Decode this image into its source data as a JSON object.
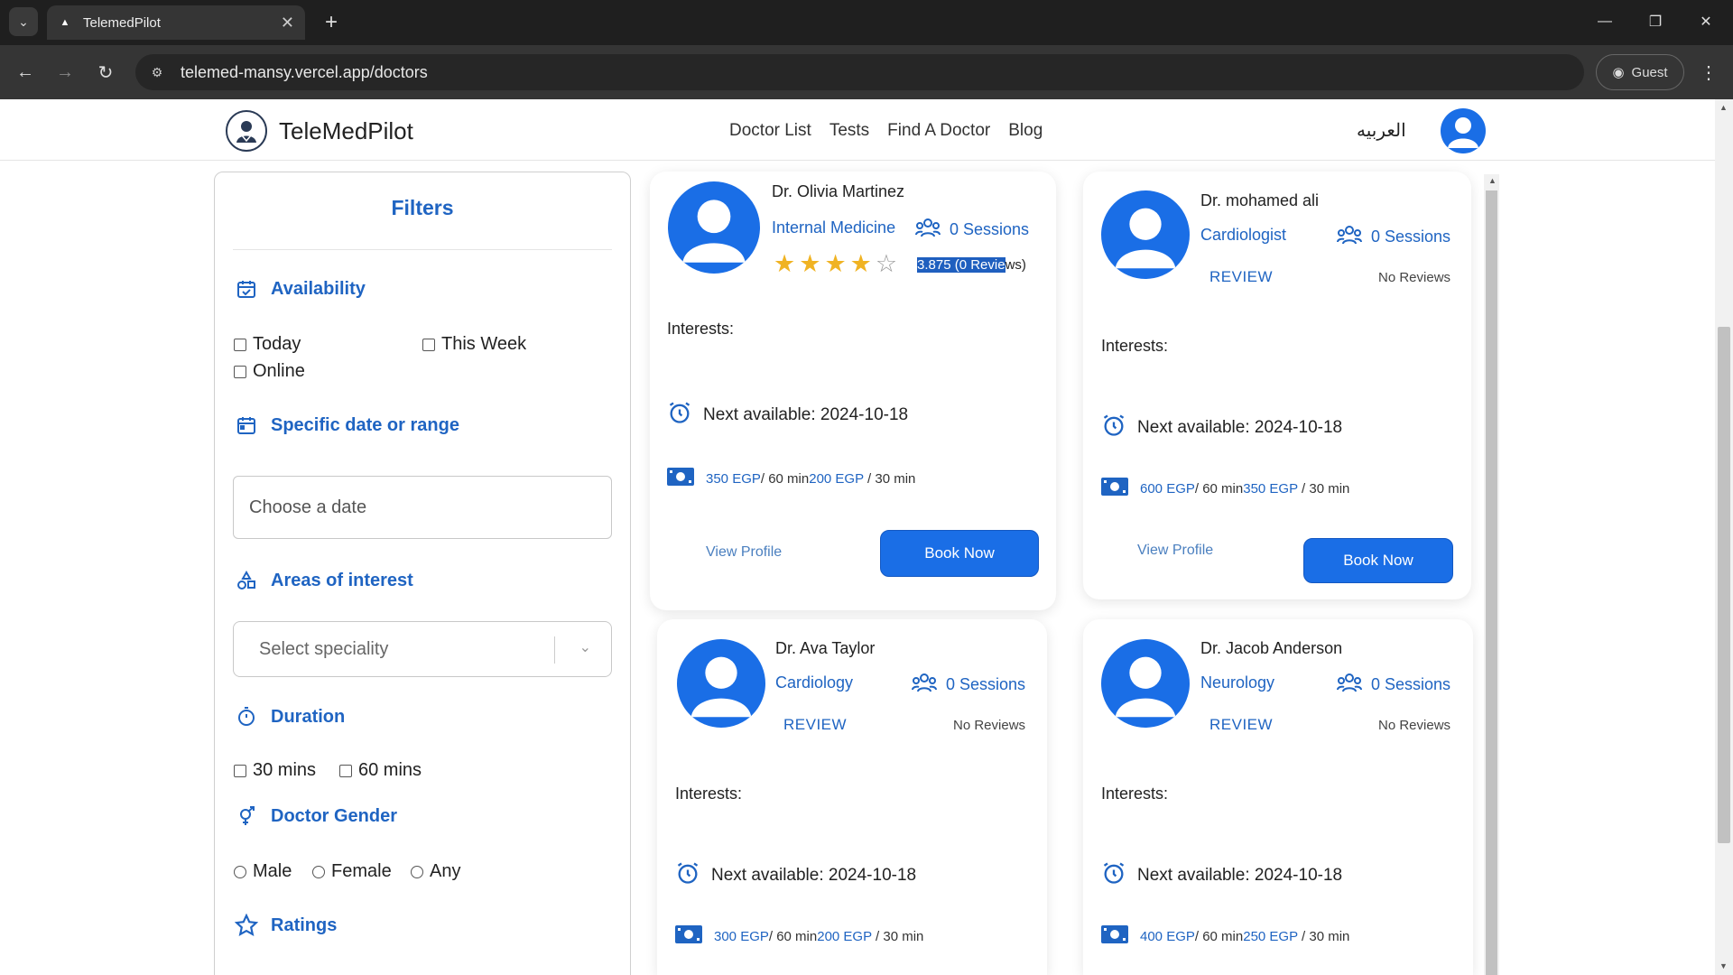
{
  "browser": {
    "tab_title": "TelemedPilot",
    "url": "telemed-mansy.vercel.app/doctors",
    "profile_label": "Guest"
  },
  "site": {
    "brand": "TeleMedPilot",
    "nav": [
      "Doctor List",
      "Tests",
      "Find A Doctor",
      "Blog"
    ],
    "language_toggle": "العربيه"
  },
  "filters": {
    "title": "Filters",
    "availability": {
      "heading": "Availability",
      "options": [
        "Today",
        "This Week",
        "Online"
      ]
    },
    "date": {
      "heading": "Specific date or range",
      "placeholder": "Choose a date"
    },
    "interests": {
      "heading": "Areas of interest",
      "placeholder": "Select speciality"
    },
    "duration": {
      "heading": "Duration",
      "options": [
        "30 mins",
        "60 mins"
      ]
    },
    "gender": {
      "heading": "Doctor Gender",
      "options": [
        "Male",
        "Female",
        "Any"
      ]
    },
    "ratings": {
      "heading": "Ratings"
    }
  },
  "doctors": [
    {
      "name": "Dr. Olivia Martinez",
      "specialty": "Internal Medicine",
      "sessions": "0 Sessions",
      "rating": 3.875,
      "rating_text_selected": "3.875 (0 Revie",
      "rating_text_rest": "ws)",
      "interests_label": "Interests:",
      "next_available": "Next available: 2024-10-18",
      "price_60": "350 EGP",
      "price_60_suffix": "/ 60 min",
      "price_30": "200 EGP",
      "price_30_suffix": " / 30 min",
      "view_profile": "View Profile",
      "book": "Book Now"
    },
    {
      "name": "Dr. mohamed ali",
      "specialty": "Cardiologist",
      "sessions": "0 Sessions",
      "review_link": "REVIEW",
      "no_reviews": "No Reviews",
      "interests_label": "Interests:",
      "next_available": "Next available: 2024-10-18",
      "price_60": "600 EGP",
      "price_60_suffix": "/ 60 min",
      "price_30": "350 EGP",
      "price_30_suffix": " / 30 min",
      "view_profile": "View Profile",
      "book": "Book Now"
    },
    {
      "name": "Dr. Ava Taylor",
      "specialty": "Cardiology",
      "sessions": "0 Sessions",
      "review_link": "REVIEW",
      "no_reviews": "No Reviews",
      "interests_label": "Interests:",
      "next_available": "Next available: 2024-10-18",
      "price_60": "300 EGP",
      "price_60_suffix": "/ 60 min",
      "price_30": "200 EGP",
      "price_30_suffix": " / 30 min"
    },
    {
      "name": "Dr. Jacob Anderson",
      "specialty": "Neurology",
      "sessions": "0 Sessions",
      "review_link": "REVIEW",
      "no_reviews": "No Reviews",
      "interests_label": "Interests:",
      "next_available": "Next available: 2024-10-18",
      "price_60": "400 EGP",
      "price_60_suffix": "/ 60 min",
      "price_30": "250 EGP",
      "price_30_suffix": " / 30 min"
    }
  ],
  "colors": {
    "accent": "#1f64c2",
    "button": "#1a6ee6",
    "star": "#f0b323"
  }
}
